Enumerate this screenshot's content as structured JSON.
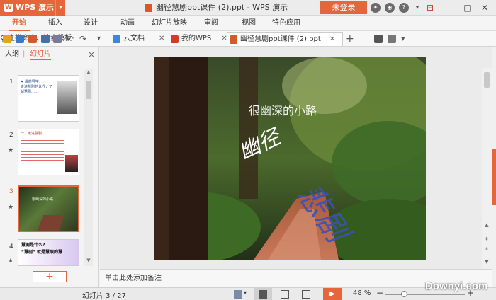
{
  "app": {
    "name": "WPS 演示"
  },
  "titlebar": {
    "document_title": "幽径慧剧ppt课件 (2).ppt - WPS 演示",
    "login_label": "未登录"
  },
  "menu": {
    "items": [
      "开始",
      "插入",
      "设计",
      "动画",
      "幻灯片放映",
      "审阅",
      "视图",
      "特色应用"
    ]
  },
  "tabs": [
    {
      "label": "云文档"
    },
    {
      "label": "我的WPS"
    },
    {
      "label": "幽径慧剧ppt课件 (2).ppt"
    }
  ],
  "search": {
    "label": "查找命令、搜索模板"
  },
  "panel": {
    "tab_outline": "大纲",
    "tab_slides": "幻灯片",
    "close": "×"
  },
  "slides": [
    {
      "number": "1",
      "thumb_text": "❤ 课前导学：\n走进慧剧的世界，了解慧剧……"
    },
    {
      "number": "2",
      "thumb_text": "一、走进慧剧……"
    },
    {
      "number": "3",
      "thumb_text": "很幽深的小路"
    },
    {
      "number": "4",
      "thumb_text": "慧剧是什么?\n“慧剧” 就是慧眼的慧"
    }
  ],
  "slide": {
    "title": "很幽深的小路",
    "art_text_1": "幽径",
    "art_text_2": "悲剧"
  },
  "notes": {
    "placeholder": "单击此处添加备注"
  },
  "status": {
    "slide_info": "幻灯片 3 / 27",
    "zoom": "48 %"
  },
  "watermark": "Downyi.com",
  "colors": {
    "accent": "#e5663a"
  }
}
